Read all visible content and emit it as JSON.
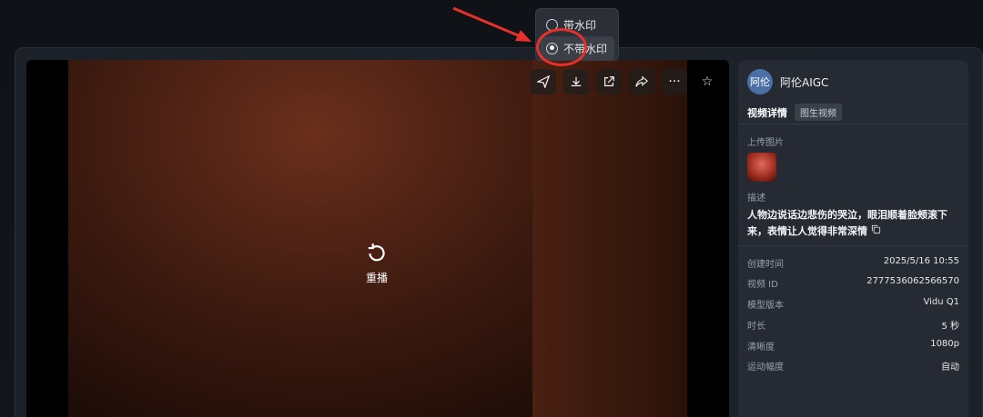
{
  "toolbar": {
    "icons": [
      "send-icon",
      "download-icon",
      "export-icon",
      "share-icon",
      "more-icon",
      "star-icon"
    ],
    "more_label": "···",
    "star_label": "☆"
  },
  "download_menu": {
    "options": [
      {
        "label": "带水印",
        "selected": false
      },
      {
        "label": "不带水印",
        "selected": true
      }
    ]
  },
  "player": {
    "replay_label": "重播"
  },
  "panel": {
    "avatar_text": "阿伦",
    "username": "阿伦AIGC",
    "tab_title": "视频详情",
    "tab_badge": "图生视频",
    "upload_label": "上传图片",
    "desc_label": "描述",
    "description": "人物边说话边悲伤的哭泣，眼泪顺着脸颊滚下来，表情让人觉得非常深情",
    "meta": [
      {
        "key": "创建时间",
        "value": "2025/5/16 10:55"
      },
      {
        "key": "视频 ID",
        "value": "2777536062566570"
      },
      {
        "key": "模型版本",
        "value": "Vidu Q1"
      },
      {
        "key": "时长",
        "value": "5 秒"
      },
      {
        "key": "清晰度",
        "value": "1080p"
      },
      {
        "key": "运动幅度",
        "value": "自动"
      }
    ]
  },
  "colors": {
    "annotation": "#e8302a",
    "panel_bg": "#252a33",
    "page_bg": "#0e1116"
  }
}
